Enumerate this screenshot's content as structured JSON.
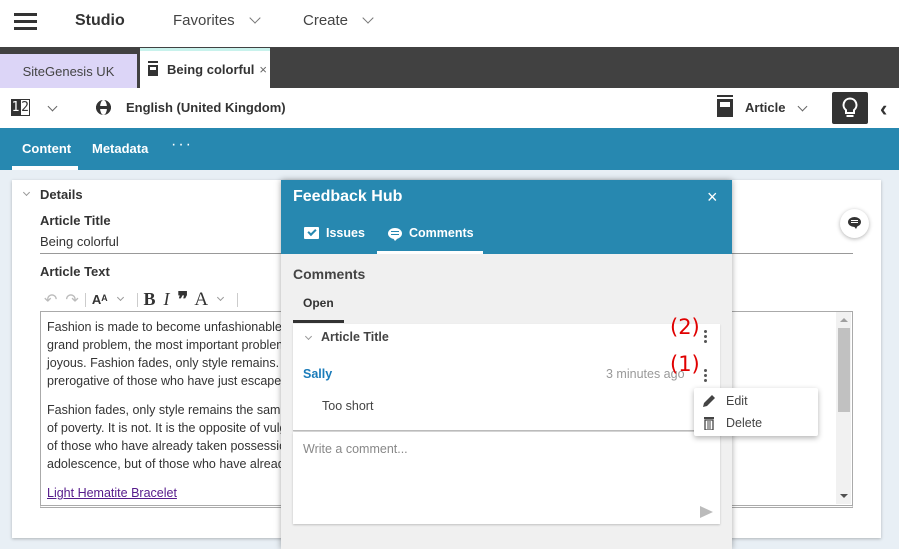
{
  "header": {
    "app_title": "Studio",
    "nav": [
      {
        "label": "Favorites"
      },
      {
        "label": "Create"
      }
    ]
  },
  "tabs": [
    {
      "label": "SiteGenesis UK"
    },
    {
      "label": "Being colorful",
      "close": "×"
    }
  ],
  "toolbar": {
    "version_icon": [
      "1",
      "2"
    ],
    "locale": "English (United Kingdom)",
    "doc_type": "Article",
    "back_glyph": "‹"
  },
  "content_tabs": {
    "items": [
      {
        "label": "Content"
      },
      {
        "label": "Metadata"
      }
    ],
    "more": "···"
  },
  "form": {
    "section": "Details",
    "title_label": "Article Title",
    "title_value": "Being colorful",
    "text_label": "Article Text",
    "editor_toolbar": {
      "font_size_glyph": "Aᴬ",
      "bold": "B",
      "italic": "I",
      "quote": "❞",
      "color": "A"
    },
    "paragraphs": [
      [
        "Fashion is made to become unfashionable. Style alone. But the",
        "grand problem, the most important problem, they feel more",
        "joyous. Fashion fades, only style remains. It is not the",
        "prerogative of those who have just escaped the future."
      ],
      [
        "Fashion fades, only style remains the same. Luxury is not the opposite",
        "of poverty. It is not. It is the opposite of vulgarity. Elegance is not the prerogative",
        "of those who have already taken possession of their future. It is not",
        "adolescence, but of those who have already escaped from"
      ]
    ],
    "link_text": "Light Hematite Bracelet"
  },
  "feedback_hub": {
    "title": "Feedback Hub",
    "close": "×",
    "tabs": [
      {
        "label": "Issues"
      },
      {
        "label": "Comments"
      }
    ],
    "section_title": "Comments",
    "filter": "Open",
    "thread": {
      "title": "Article Title",
      "comment": {
        "author": "Sally",
        "time": "3 minutes ago",
        "text": "Too short"
      }
    },
    "composer_placeholder": "Write a comment..."
  },
  "annotations": {
    "a1": "(1)",
    "a2": "(2)"
  },
  "context_menu": {
    "items": [
      {
        "label": "Edit"
      },
      {
        "label": "Delete"
      }
    ]
  }
}
